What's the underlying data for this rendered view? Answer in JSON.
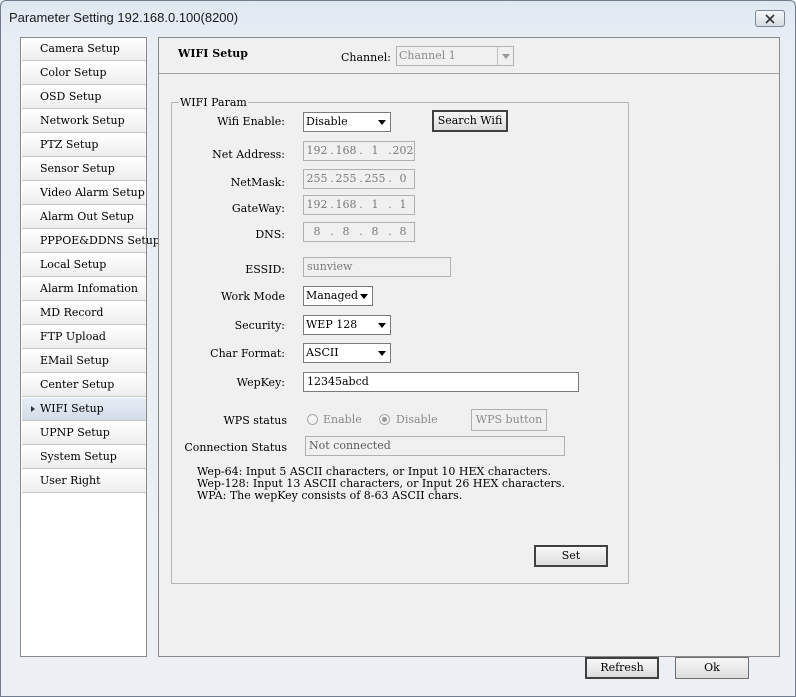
{
  "window": {
    "title": "Parameter Setting 192.168.0.100(8200)"
  },
  "sidebar": {
    "items": [
      {
        "label": "Camera Setup",
        "active": false
      },
      {
        "label": "Color Setup",
        "active": false
      },
      {
        "label": "OSD Setup",
        "active": false
      },
      {
        "label": "Network Setup",
        "active": false
      },
      {
        "label": "PTZ Setup",
        "active": false
      },
      {
        "label": "Sensor Setup",
        "active": false
      },
      {
        "label": "Video Alarm Setup",
        "active": false
      },
      {
        "label": "Alarm Out Setup",
        "active": false
      },
      {
        "label": "PPPOE&DDNS Setup",
        "active": false
      },
      {
        "label": "Local Setup",
        "active": false
      },
      {
        "label": "Alarm Infomation",
        "active": false
      },
      {
        "label": "MD Record",
        "active": false
      },
      {
        "label": "FTP Upload",
        "active": false
      },
      {
        "label": "EMail Setup",
        "active": false
      },
      {
        "label": "Center Setup",
        "active": false
      },
      {
        "label": "WIFI Setup",
        "active": true
      },
      {
        "label": "UPNP Setup",
        "active": false
      },
      {
        "label": "System Setup",
        "active": false
      },
      {
        "label": "User Right",
        "active": false
      }
    ]
  },
  "main": {
    "title": "WIFI Setup",
    "channel_label": "Channel:",
    "channel_value": "Channel 1",
    "group_label": "WIFI Param",
    "wifi_enable_label": "Wifi Enable:",
    "wifi_enable_value": "Disable",
    "search_wifi_label": "Search Wifi",
    "net_address_label": "Net Address:",
    "net_address": [
      "192",
      "168",
      "1",
      "202"
    ],
    "netmask_label": "NetMask:",
    "netmask": [
      "255",
      "255",
      "255",
      "0"
    ],
    "gateway_label": "GateWay:",
    "gateway": [
      "192",
      "168",
      "1",
      "1"
    ],
    "dns_label": "DNS:",
    "dns": [
      "8",
      "8",
      "8",
      "8"
    ],
    "essid_label": "ESSID:",
    "essid_value": "sunview",
    "work_mode_label": "Work Mode",
    "work_mode_value": "Managed",
    "security_label": "Security:",
    "security_value": "WEP 128",
    "char_format_label": "Char Format:",
    "char_format_value": "ASCII",
    "wepkey_label": "WepKey:",
    "wepkey_value": "12345abcd",
    "wps_status_label": "WPS status",
    "wps_enable_label": "Enable",
    "wps_disable_label": "Disable",
    "wps_selected": "Disable",
    "wps_button_label": "WPS button",
    "connection_status_label": "Connection Status",
    "connection_status_value": "Not connected",
    "notes": [
      "Wep-64: Input 5 ASCII characters, or Input 10 HEX characters.",
      "Wep-128: Input 13 ASCII characters, or Input 26 HEX characters.",
      "WPA: The wepKey consists of 8-63 ASCII chars."
    ],
    "set_label": "Set"
  },
  "footer": {
    "refresh_label": "Refresh",
    "ok_label": "Ok"
  },
  "colors": {
    "window_bg": "#eaeff5",
    "panel_bg": "#f0f0f0",
    "active_item": "#d8e2ec"
  }
}
